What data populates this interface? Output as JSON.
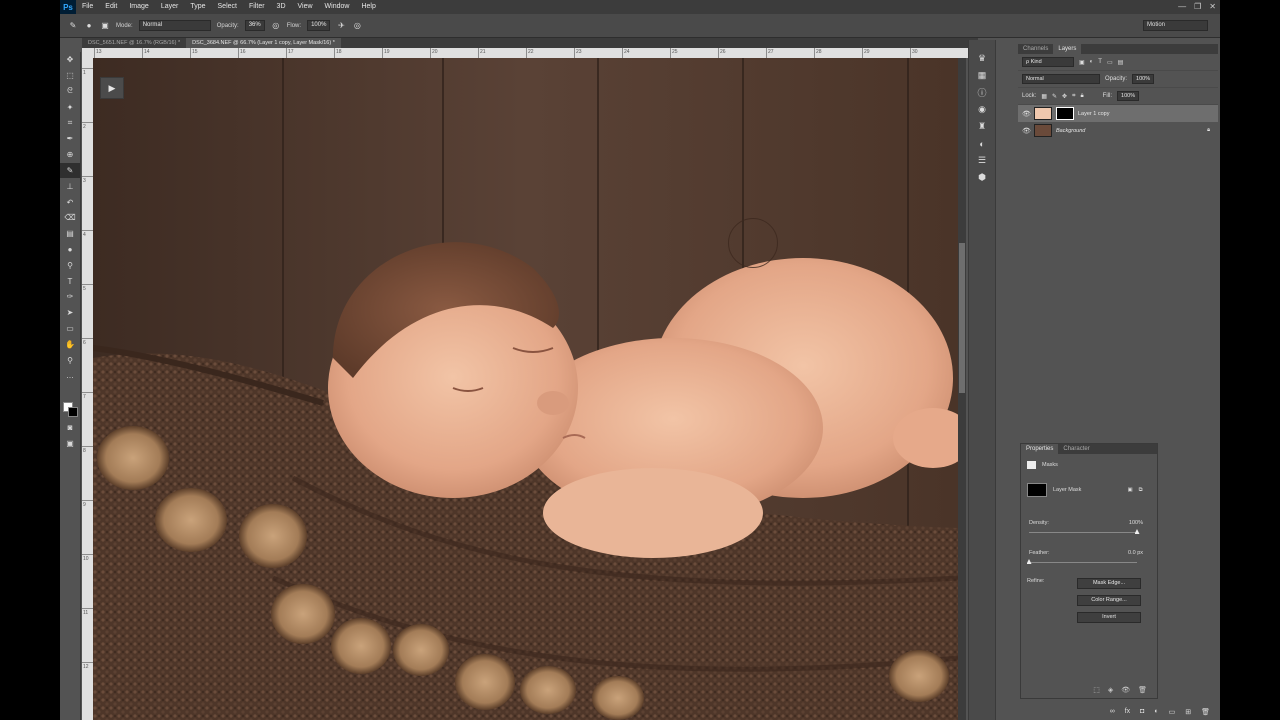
{
  "app": {
    "logo": "Ps"
  },
  "menu": [
    "File",
    "Edit",
    "Image",
    "Layer",
    "Type",
    "Select",
    "Filter",
    "3D",
    "View",
    "Window",
    "Help"
  ],
  "window_controls": [
    "—",
    "❐",
    "✕"
  ],
  "options": {
    "mode_label": "Mode:",
    "mode_value": "Normal",
    "opacity_label": "Opacity:",
    "opacity_value": "36%",
    "flow_label": "Flow:",
    "flow_value": "100%",
    "workspace": "Motion"
  },
  "tabs": [
    "DSC_5651.NEF @ 16.7% (RGB/16) *",
    "DSC_3684.NEF @ 66.7% (Layer 1 copy, Layer Mask/16) *"
  ],
  "ruler_h": [
    "13",
    "14",
    "15",
    "16",
    "17",
    "18",
    "19",
    "20",
    "21",
    "22",
    "23",
    "24",
    "25",
    "26",
    "27",
    "28",
    "29",
    "30"
  ],
  "ruler_v": [
    "1",
    "2",
    "3",
    "4",
    "5",
    "6",
    "7",
    "8",
    "9",
    "10",
    "11",
    "12"
  ],
  "canvas": {
    "play_icon": "▶"
  },
  "panels": {
    "tabs": [
      "Channels",
      "Layers"
    ],
    "filter_kind": "ρ Kind",
    "blend_mode": "Normal",
    "opacity_label": "Opacity:",
    "opacity_value": "100%",
    "lock_label": "Lock:",
    "fill_label": "Fill:",
    "fill_value": "100%",
    "layers": [
      {
        "name": "Layer 1 copy",
        "selected": true
      },
      {
        "name": "Background",
        "selected": false,
        "locked": true
      }
    ]
  },
  "properties": {
    "tabs": [
      "Properties",
      "Character"
    ],
    "section": "Masks",
    "mask_name": "Layer Mask",
    "density_label": "Density:",
    "density_value": "100%",
    "density": 1.0,
    "feather_label": "Feather:",
    "feather_value": "0.0 px",
    "feather": 0.0,
    "refine_label": "Refine:",
    "btn_mask_edge": "Mask Edge...",
    "btn_color_range": "Color Range...",
    "btn_invert": "Invert"
  }
}
